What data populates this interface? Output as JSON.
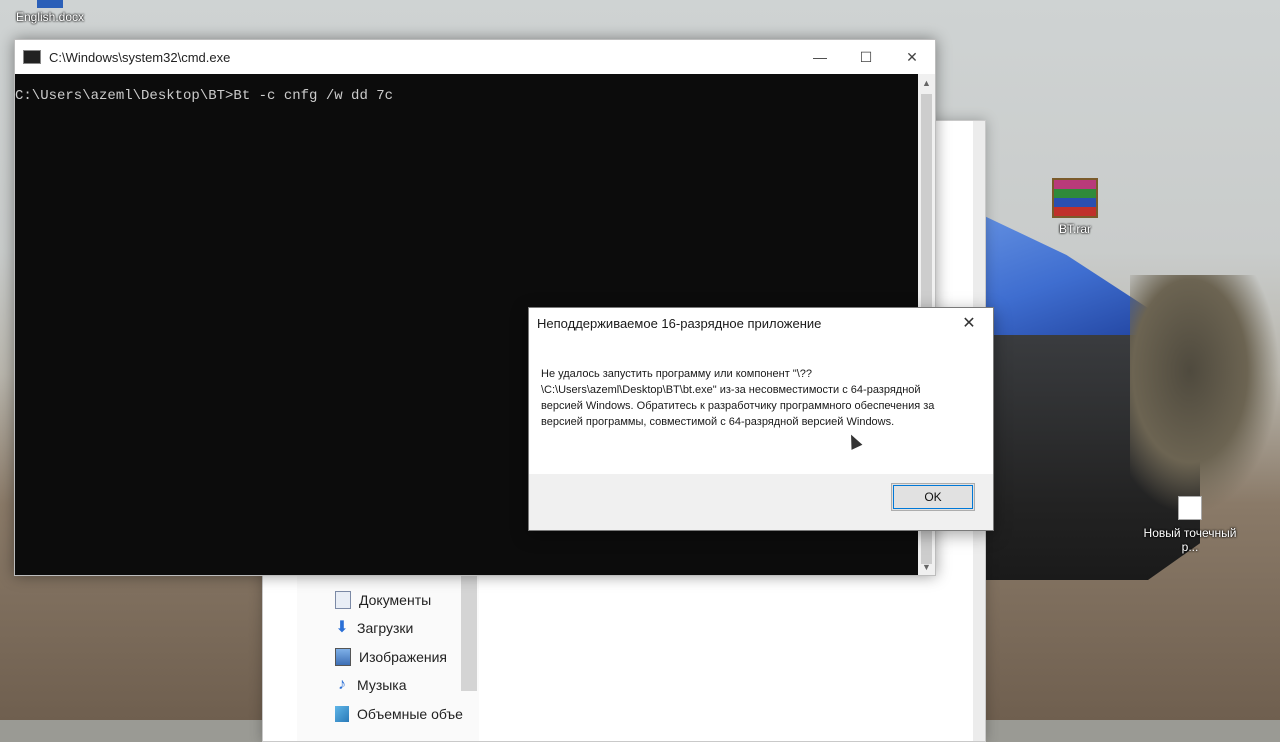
{
  "desktop": {
    "icons": [
      {
        "label": "English.docx",
        "icon": "word-document-icon"
      },
      {
        "label": "BT.rar",
        "icon": "winrar-archive-icon"
      },
      {
        "label": "Новый точечный р...",
        "icon": "bitmap-file-icon"
      }
    ]
  },
  "explorer": {
    "nav_items": [
      {
        "label": "Документы",
        "icon": "documents-icon"
      },
      {
        "label": "Загрузки",
        "icon": "downloads-icon"
      },
      {
        "label": "Изображения",
        "icon": "pictures-icon"
      },
      {
        "label": "Музыка",
        "icon": "music-icon"
      },
      {
        "label": "Объемные объе",
        "icon": "3d-objects-icon"
      }
    ]
  },
  "cmd": {
    "title": "C:\\Windows\\system32\\cmd.exe",
    "minimize": "—",
    "maximize": "☐",
    "close": "✕",
    "prompt_line": "C:\\Users\\azeml\\Desktop\\BT>Bt -c cnfg /w dd 7c"
  },
  "dialog": {
    "title": "Неподдерживаемое 16-разрядное приложение",
    "close": "✕",
    "message": "Не удалось запустить программу или компонент \"\\??\\C:\\Users\\azeml\\Desktop\\BT\\bt.exe\" из-за несовместимости с 64-разрядной версией Windows. Обратитесь к разработчику программного обеспечения за версией программы, совместимой с 64-разрядной версией Windows.",
    "ok_label": "OK"
  }
}
